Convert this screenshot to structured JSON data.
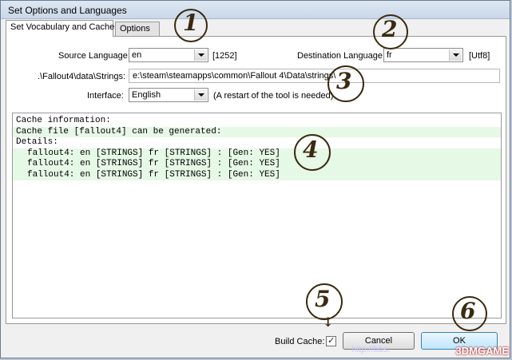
{
  "window": {
    "title": "Set Options and Languages"
  },
  "tabs": [
    {
      "label": "Set Vocabulary and Cache",
      "active": true
    },
    {
      "label": "Options",
      "active": false
    }
  ],
  "form": {
    "source_language_label": "Source Language:",
    "source_language_value": "en",
    "source_codepage": "[1252]",
    "destination_language_label": "Destination Language:",
    "destination_language_value": "fr",
    "destination_codepage": "[Utf8]",
    "strings_path_label": ".\\Fallout4\\data\\Strings:",
    "strings_path_value": "e:\\steam\\steamapps\\common\\Fallout 4\\Data\\strings\\",
    "interface_label": "Interface:",
    "interface_value": "English",
    "restart_note": "(A restart of the tool is needed)"
  },
  "log": {
    "lines": [
      {
        "text": "Cache information:",
        "style": "plain"
      },
      {
        "text": "Cache file [fallout4] can be generated:",
        "style": "green"
      },
      {
        "text": "Details:",
        "style": "plain"
      },
      {
        "text": "fallout4: en [STRINGS] fr [STRINGS] : [Gen: YES]",
        "style": "green-indent"
      },
      {
        "text": "fallout4: en [STRINGS] fr [STRINGS] : [Gen: YES]",
        "style": "green-indent"
      },
      {
        "text": "fallout4: en [STRINGS] fr [STRINGS] : [Gen: YES]",
        "style": "green-indent"
      }
    ]
  },
  "footer": {
    "build_cache_label": "Build Cache:",
    "build_cache_checked": true,
    "cancel_label": "Cancel",
    "ok_label": "OK"
  },
  "annotations": [
    "1",
    "2",
    "3",
    "4",
    "5",
    "6"
  ],
  "watermark": {
    "text": "3DMGAME",
    "url": "http://bbs."
  },
  "colors": {
    "log_highlight": "#e6f8e6",
    "annotation_ink": "#3a2a10"
  }
}
